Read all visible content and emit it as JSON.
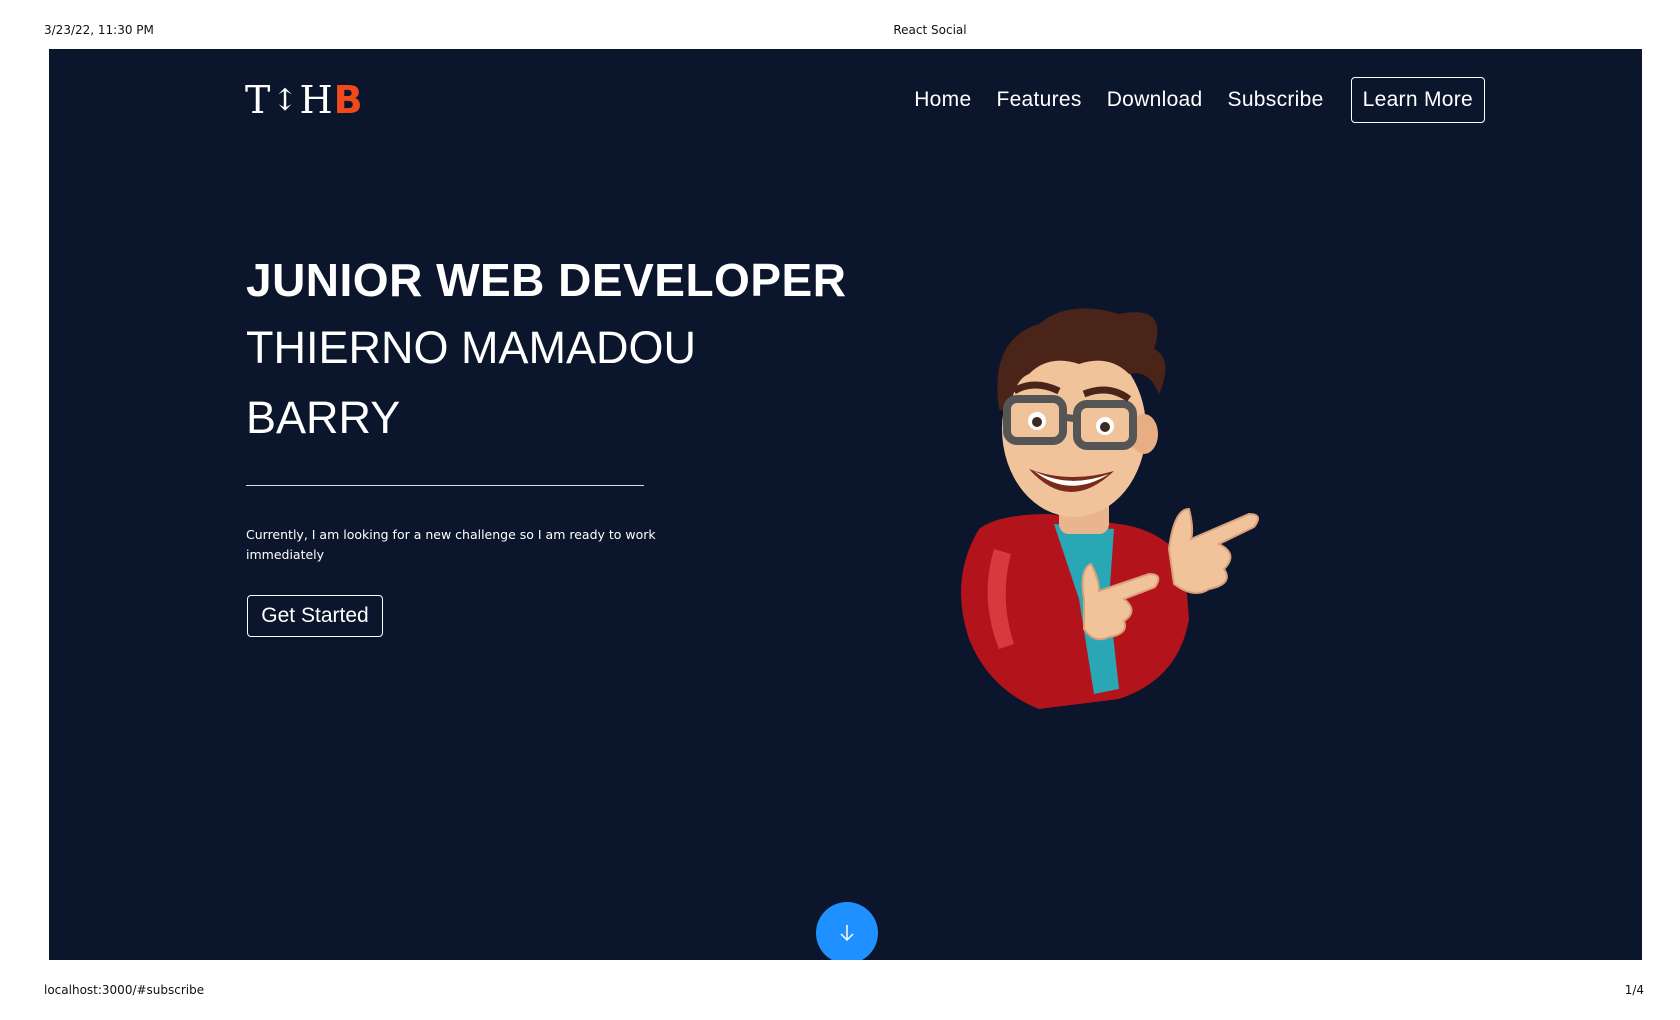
{
  "print": {
    "datetime": "3/23/22, 11:30 PM",
    "title": "React Social",
    "url": "localhost:3000/#subscribe",
    "page_indicator": "1/4"
  },
  "navbar": {
    "brand": {
      "part1": "T",
      "arrow": "↕",
      "part2": "H",
      "part3": "B",
      "accent_color": "#f04a1a"
    },
    "links": [
      "Home",
      "Features",
      "Download",
      "Subscribe"
    ],
    "cta_label": "Learn More"
  },
  "hero": {
    "role": "JUNIOR WEB DEVELOPER",
    "name_line1": "THIERNO MAMADOU",
    "name_line2": "BARRY",
    "description": "Currently, I am looking for a new challenge so I am ready to work immediately",
    "button_label": "Get Started",
    "illustration_icon": "cartoon-developer-pointing"
  },
  "scroll_button": {
    "icon": "arrow-down-icon",
    "color": "#1e90ff"
  },
  "theme": {
    "background": "#0b162c",
    "text": "#ffffff"
  }
}
